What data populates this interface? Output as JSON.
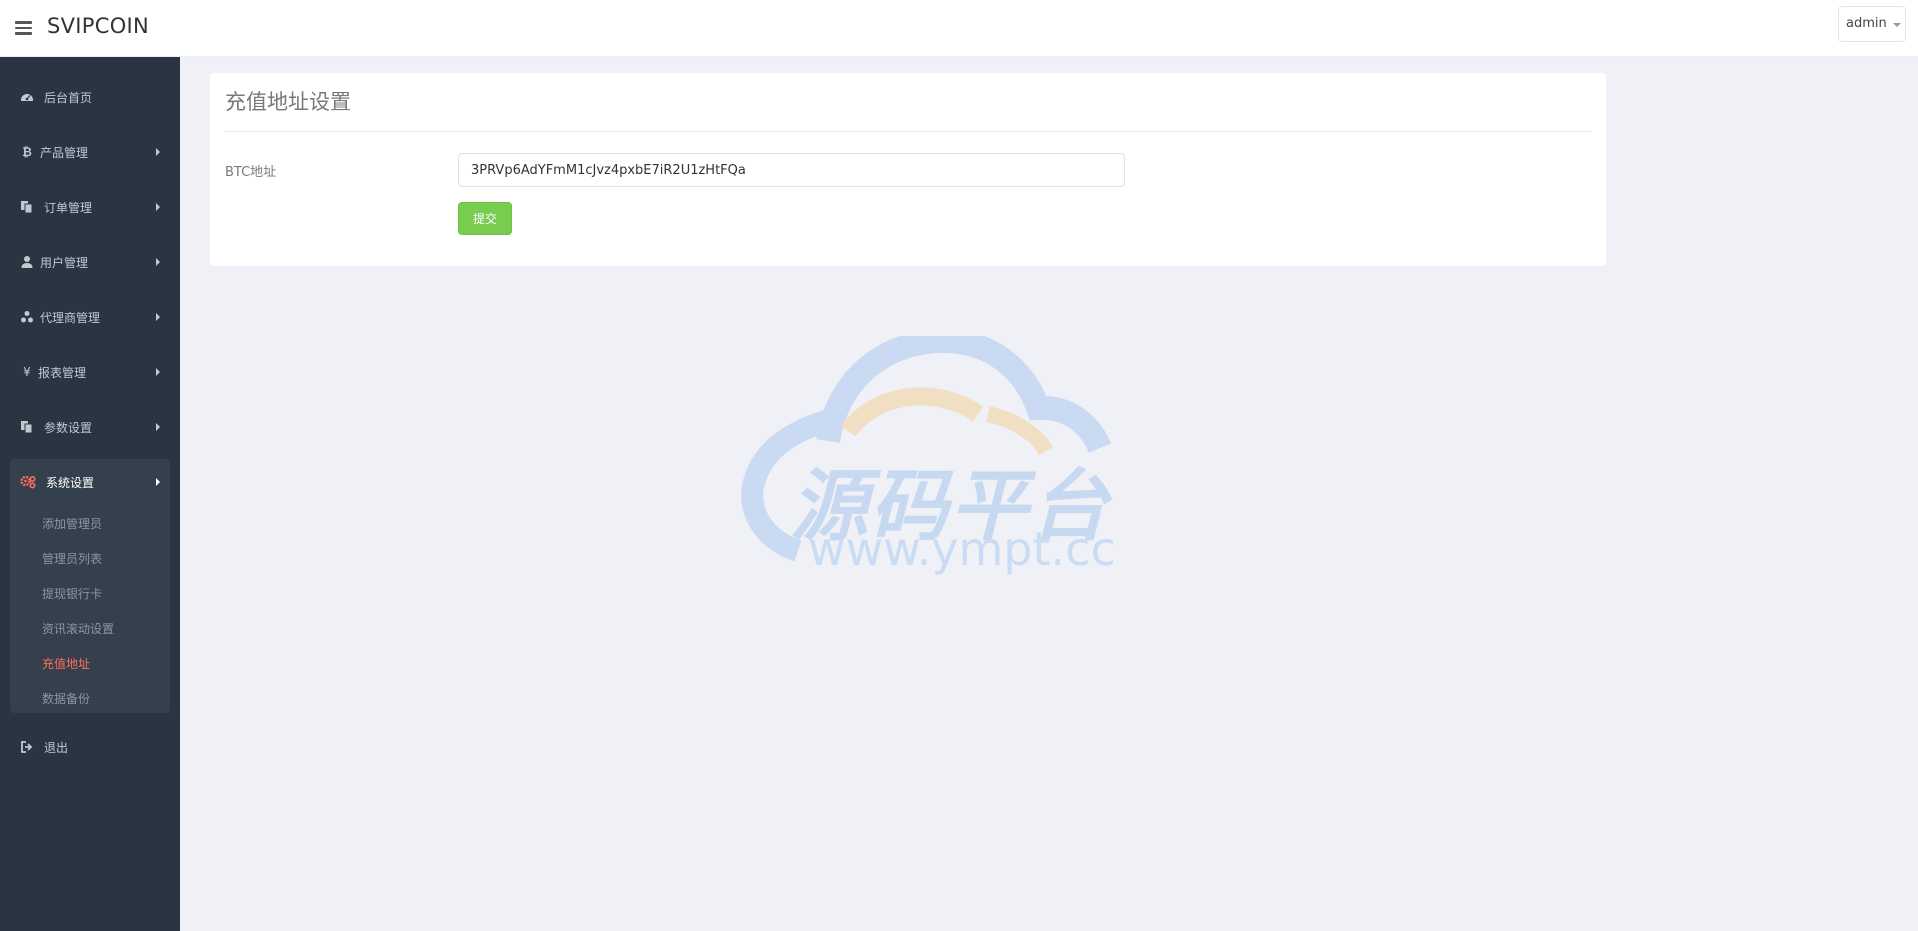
{
  "header": {
    "brand": "SVIPCOIN",
    "user": "admin"
  },
  "sidebar": {
    "items": [
      {
        "label": "后台首页",
        "icon": "dashboard-icon"
      },
      {
        "label": "产品管理",
        "icon": "bitcoin-icon"
      },
      {
        "label": "订单管理",
        "icon": "copy-icon"
      },
      {
        "label": "用户管理",
        "icon": "user-icon"
      },
      {
        "label": "代理商管理",
        "icon": "sitemap-icon"
      },
      {
        "label": "报表管理",
        "icon": "yen-icon"
      },
      {
        "label": "参数设置",
        "icon": "copy-icon"
      },
      {
        "label": "系统设置",
        "icon": "gears-icon"
      },
      {
        "label": "退出",
        "icon": "sign-out-icon"
      }
    ],
    "system_sub": [
      {
        "label": "添加管理员"
      },
      {
        "label": "管理员列表"
      },
      {
        "label": "提现银行卡"
      },
      {
        "label": "资讯滚动设置"
      },
      {
        "label": "充值地址"
      },
      {
        "label": "数据备份"
      }
    ],
    "active_color": "#ff6c60"
  },
  "main": {
    "title": "充值地址设置",
    "btc_label": "BTC地址",
    "btc_value": "3PRVp6AdYFmM1cJvz4pxbE7iR2U1zHtFQa",
    "submit_label": "提交"
  },
  "watermark": {
    "text": "源码平台",
    "url": "www.ympt.cc"
  }
}
